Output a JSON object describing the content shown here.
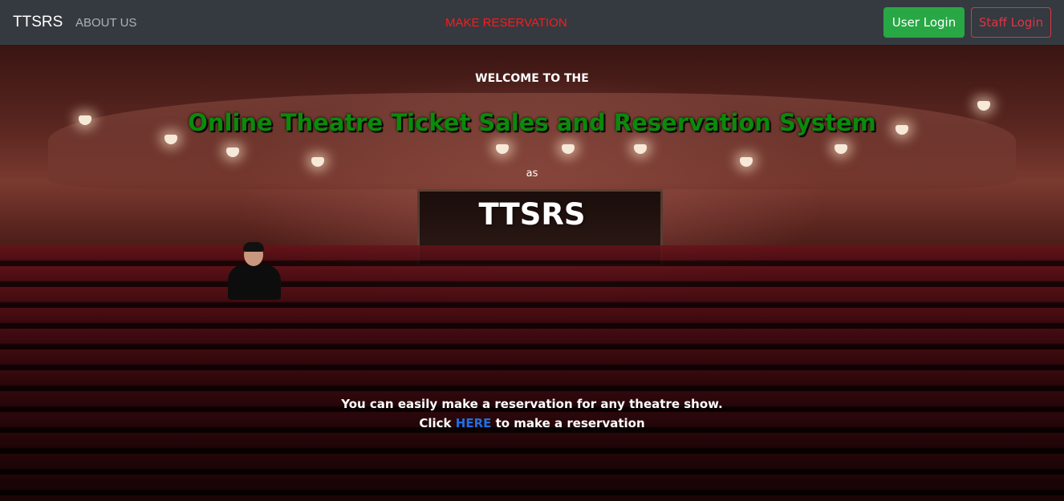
{
  "navbar": {
    "brand": "TTSRS",
    "about_label": "ABOUT US",
    "reservation_label": "MAKE RESERVATION",
    "user_login_label": "User Login",
    "staff_login_label": "Staff Login"
  },
  "hero": {
    "welcome": "WELCOME TO THE",
    "title": "Online Theatre Ticket Sales and Reservation System",
    "as_text": "as",
    "acronym": "TTSRS",
    "description_line1": "You can easily make a reservation for any theatre show.",
    "click_prefix": "Click",
    "here_link": "HERE",
    "click_suffix": "to make a reservation",
    "background_image": "theatre-auditorium-image"
  },
  "colors": {
    "navbar_bg": "#343a40",
    "reservation_link": "#ff1a1a",
    "user_login_bg": "#28a745",
    "staff_login_border": "#dc3545",
    "title_green": "#0b8a0b",
    "here_link": "#1e6fe6"
  }
}
